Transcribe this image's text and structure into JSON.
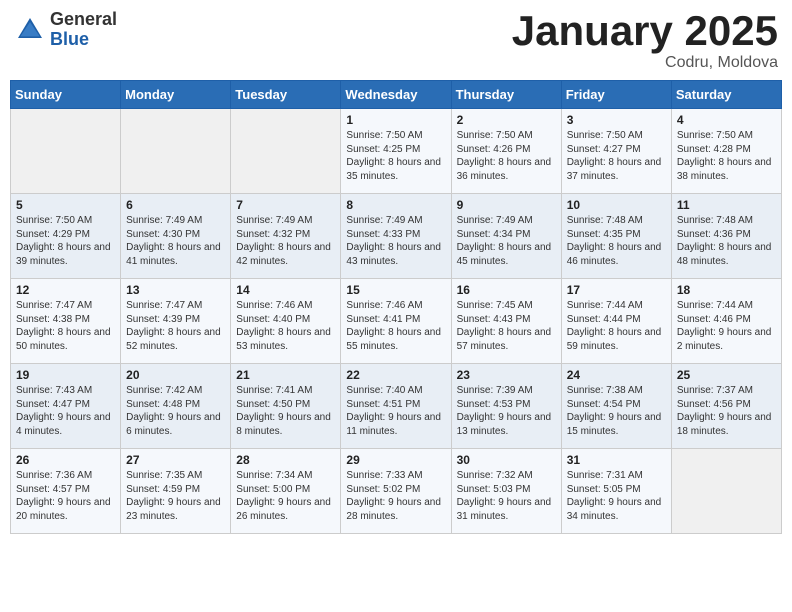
{
  "header": {
    "logo_general": "General",
    "logo_blue": "Blue",
    "month_year": "January 2025",
    "location": "Codru, Moldova"
  },
  "days_of_week": [
    "Sunday",
    "Monday",
    "Tuesday",
    "Wednesday",
    "Thursday",
    "Friday",
    "Saturday"
  ],
  "weeks": [
    [
      {
        "day": "",
        "info": ""
      },
      {
        "day": "",
        "info": ""
      },
      {
        "day": "",
        "info": ""
      },
      {
        "day": "1",
        "info": "Sunrise: 7:50 AM\nSunset: 4:25 PM\nDaylight: 8 hours and 35 minutes."
      },
      {
        "day": "2",
        "info": "Sunrise: 7:50 AM\nSunset: 4:26 PM\nDaylight: 8 hours and 36 minutes."
      },
      {
        "day": "3",
        "info": "Sunrise: 7:50 AM\nSunset: 4:27 PM\nDaylight: 8 hours and 37 minutes."
      },
      {
        "day": "4",
        "info": "Sunrise: 7:50 AM\nSunset: 4:28 PM\nDaylight: 8 hours and 38 minutes."
      }
    ],
    [
      {
        "day": "5",
        "info": "Sunrise: 7:50 AM\nSunset: 4:29 PM\nDaylight: 8 hours and 39 minutes."
      },
      {
        "day": "6",
        "info": "Sunrise: 7:49 AM\nSunset: 4:30 PM\nDaylight: 8 hours and 41 minutes."
      },
      {
        "day": "7",
        "info": "Sunrise: 7:49 AM\nSunset: 4:32 PM\nDaylight: 8 hours and 42 minutes."
      },
      {
        "day": "8",
        "info": "Sunrise: 7:49 AM\nSunset: 4:33 PM\nDaylight: 8 hours and 43 minutes."
      },
      {
        "day": "9",
        "info": "Sunrise: 7:49 AM\nSunset: 4:34 PM\nDaylight: 8 hours and 45 minutes."
      },
      {
        "day": "10",
        "info": "Sunrise: 7:48 AM\nSunset: 4:35 PM\nDaylight: 8 hours and 46 minutes."
      },
      {
        "day": "11",
        "info": "Sunrise: 7:48 AM\nSunset: 4:36 PM\nDaylight: 8 hours and 48 minutes."
      }
    ],
    [
      {
        "day": "12",
        "info": "Sunrise: 7:47 AM\nSunset: 4:38 PM\nDaylight: 8 hours and 50 minutes."
      },
      {
        "day": "13",
        "info": "Sunrise: 7:47 AM\nSunset: 4:39 PM\nDaylight: 8 hours and 52 minutes."
      },
      {
        "day": "14",
        "info": "Sunrise: 7:46 AM\nSunset: 4:40 PM\nDaylight: 8 hours and 53 minutes."
      },
      {
        "day": "15",
        "info": "Sunrise: 7:46 AM\nSunset: 4:41 PM\nDaylight: 8 hours and 55 minutes."
      },
      {
        "day": "16",
        "info": "Sunrise: 7:45 AM\nSunset: 4:43 PM\nDaylight: 8 hours and 57 minutes."
      },
      {
        "day": "17",
        "info": "Sunrise: 7:44 AM\nSunset: 4:44 PM\nDaylight: 8 hours and 59 minutes."
      },
      {
        "day": "18",
        "info": "Sunrise: 7:44 AM\nSunset: 4:46 PM\nDaylight: 9 hours and 2 minutes."
      }
    ],
    [
      {
        "day": "19",
        "info": "Sunrise: 7:43 AM\nSunset: 4:47 PM\nDaylight: 9 hours and 4 minutes."
      },
      {
        "day": "20",
        "info": "Sunrise: 7:42 AM\nSunset: 4:48 PM\nDaylight: 9 hours and 6 minutes."
      },
      {
        "day": "21",
        "info": "Sunrise: 7:41 AM\nSunset: 4:50 PM\nDaylight: 9 hours and 8 minutes."
      },
      {
        "day": "22",
        "info": "Sunrise: 7:40 AM\nSunset: 4:51 PM\nDaylight: 9 hours and 11 minutes."
      },
      {
        "day": "23",
        "info": "Sunrise: 7:39 AM\nSunset: 4:53 PM\nDaylight: 9 hours and 13 minutes."
      },
      {
        "day": "24",
        "info": "Sunrise: 7:38 AM\nSunset: 4:54 PM\nDaylight: 9 hours and 15 minutes."
      },
      {
        "day": "25",
        "info": "Sunrise: 7:37 AM\nSunset: 4:56 PM\nDaylight: 9 hours and 18 minutes."
      }
    ],
    [
      {
        "day": "26",
        "info": "Sunrise: 7:36 AM\nSunset: 4:57 PM\nDaylight: 9 hours and 20 minutes."
      },
      {
        "day": "27",
        "info": "Sunrise: 7:35 AM\nSunset: 4:59 PM\nDaylight: 9 hours and 23 minutes."
      },
      {
        "day": "28",
        "info": "Sunrise: 7:34 AM\nSunset: 5:00 PM\nDaylight: 9 hours and 26 minutes."
      },
      {
        "day": "29",
        "info": "Sunrise: 7:33 AM\nSunset: 5:02 PM\nDaylight: 9 hours and 28 minutes."
      },
      {
        "day": "30",
        "info": "Sunrise: 7:32 AM\nSunset: 5:03 PM\nDaylight: 9 hours and 31 minutes."
      },
      {
        "day": "31",
        "info": "Sunrise: 7:31 AM\nSunset: 5:05 PM\nDaylight: 9 hours and 34 minutes."
      },
      {
        "day": "",
        "info": ""
      }
    ]
  ]
}
